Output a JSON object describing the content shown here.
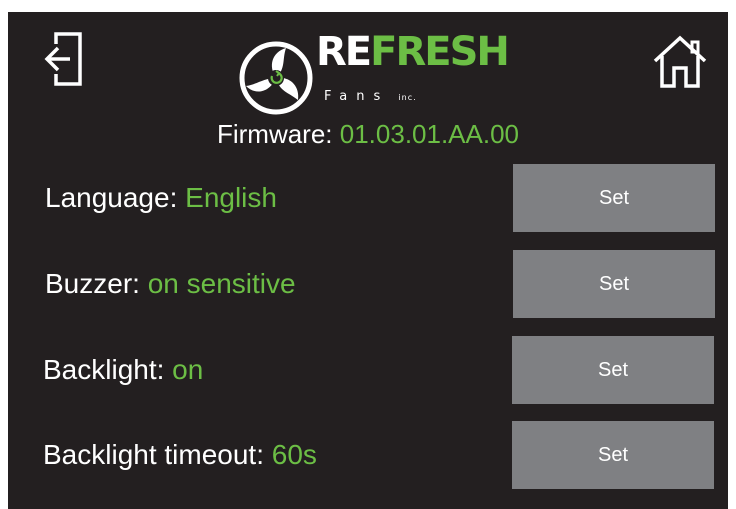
{
  "header": {
    "exit_icon": "exit-door-icon",
    "home_icon": "home-icon",
    "logo": {
      "brand_white": "RE",
      "brand_green": "FRESH",
      "tagline": "Fans",
      "tagline_suffix": "inc."
    }
  },
  "firmware": {
    "label": "Firmware: ",
    "value": "01.03.01.AA.00"
  },
  "settings": [
    {
      "label": "Language: ",
      "value": "English",
      "button": "Set"
    },
    {
      "label": "Buzzer: ",
      "value": "on sensitive",
      "button": "Set"
    },
    {
      "label": "Backlight: ",
      "value": "on",
      "button": "Set"
    },
    {
      "label": "Backlight timeout: ",
      "value": "60s",
      "button": "Set"
    }
  ],
  "colors": {
    "background": "#231f20",
    "accent_green": "#6cbe45",
    "button_gray": "#7f8083",
    "text_white": "#ffffff"
  }
}
